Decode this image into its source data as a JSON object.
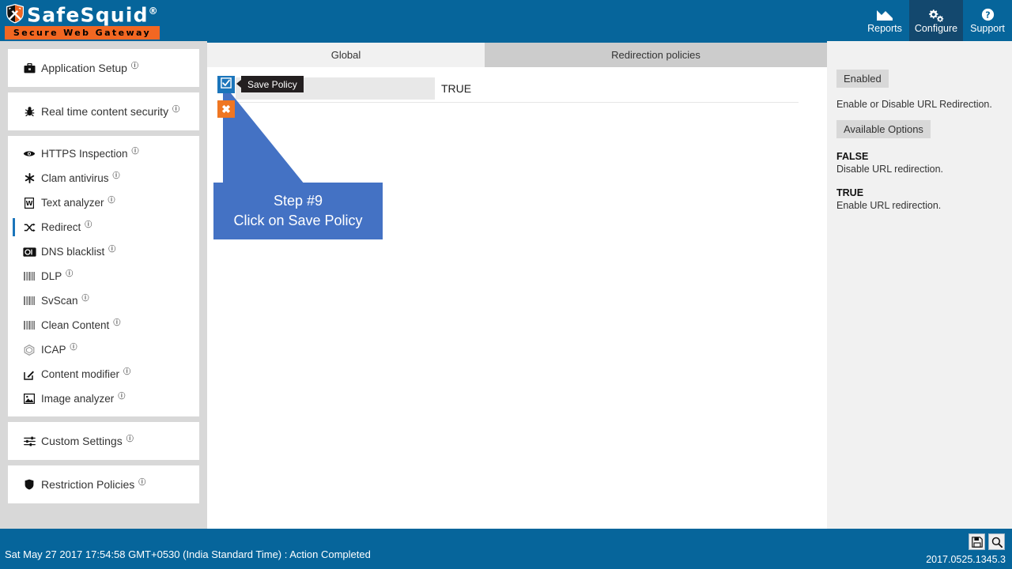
{
  "brand": {
    "name": "SafeSquid",
    "registered": "®",
    "tagline": "Secure Web Gateway",
    "shield_icon": "safesquid-shield-icon"
  },
  "nav": {
    "items": [
      {
        "label": "Reports",
        "icon": "chart-icon",
        "active": false
      },
      {
        "label": "Configure",
        "icon": "gears-icon",
        "active": true
      },
      {
        "label": "Support",
        "icon": "question-circle-icon",
        "active": false
      }
    ]
  },
  "sidebar": {
    "groups": [
      {
        "items": [
          {
            "label": "Application Setup",
            "icon": "briefcase-icon",
            "info": "ⓘ",
            "active": false
          }
        ]
      },
      {
        "items": [
          {
            "label": "Real time content security",
            "icon": "shield-bug-icon",
            "info": "ⓘ",
            "active": false
          }
        ]
      },
      {
        "items": [
          {
            "label": "HTTPS Inspection",
            "icon": "eye-icon",
            "info": "ⓘ",
            "active": false
          },
          {
            "label": "Clam antivirus",
            "icon": "asterisk-icon",
            "info": "ⓘ",
            "active": false
          },
          {
            "label": "Text analyzer",
            "icon": "text-document-icon",
            "info": "ⓘ",
            "active": false
          },
          {
            "label": "Redirect",
            "icon": "shuffle-icon",
            "info": "ⓘ",
            "active": true
          },
          {
            "label": "DNS blacklist",
            "icon": "dns-badge-icon",
            "info": "ⓘ",
            "active": false
          },
          {
            "label": "DLP",
            "icon": "bars-icon",
            "info": "ⓘ",
            "active": false
          },
          {
            "label": "SvScan",
            "icon": "bars-icon",
            "info": "ⓘ",
            "active": false
          },
          {
            "label": "Clean Content",
            "icon": "bars-icon",
            "info": "ⓘ",
            "active": false
          },
          {
            "label": "ICAP",
            "icon": "hexagon-icon",
            "info": "ⓘ",
            "active": false
          },
          {
            "label": "Content modifier",
            "icon": "edit-square-icon",
            "info": "ⓘ",
            "active": false
          },
          {
            "label": "Image analyzer",
            "icon": "image-icon",
            "info": "ⓘ",
            "active": false
          }
        ]
      },
      {
        "items": [
          {
            "label": "Custom Settings",
            "icon": "sliders-icon",
            "info": "ⓘ",
            "active": false
          }
        ]
      },
      {
        "items": [
          {
            "label": "Restriction Policies",
            "icon": "shield-icon",
            "info": "ⓘ",
            "active": false
          }
        ]
      }
    ]
  },
  "tabs": [
    {
      "label": "Global",
      "active": true
    },
    {
      "label": "Redirection policies",
      "active": false
    }
  ],
  "toolbar": {
    "save_icon": "checkbox-checked-icon",
    "save_tooltip": "Save Policy",
    "cancel_icon": "close-x-icon",
    "cancel_label": "✖"
  },
  "form": {
    "rows": [
      {
        "key": "",
        "value": "TRUE"
      }
    ]
  },
  "callout": {
    "step": "Step #9",
    "instruction": "Click on Save Policy",
    "color": "#4472C4"
  },
  "help": {
    "title_chip": "Enabled",
    "description": "Enable or Disable URL Redirection.",
    "options_chip": "Available Options",
    "options": [
      {
        "name": "FALSE",
        "desc": "Disable URL redirection."
      },
      {
        "name": "TRUE",
        "desc": "Enable URL redirection."
      }
    ]
  },
  "statusbar": {
    "message": "Sat May 27 2017 17:54:58 GMT+0530 (India Standard Time) : Action Completed",
    "version": "2017.0525.1345.3",
    "buttons": [
      {
        "icon": "floppy-save-icon"
      },
      {
        "icon": "search-icon"
      }
    ]
  },
  "colors": {
    "header_blue": "#06659B",
    "nav_active": "#13486E",
    "accent_orange": "#F26722",
    "save_blue": "#1B75BB",
    "callout_blue": "#4472C4",
    "sidebar_bg": "#D8D8D8",
    "tab_active": "#F1F1F1",
    "tab_inactive": "#CCCCCC"
  }
}
